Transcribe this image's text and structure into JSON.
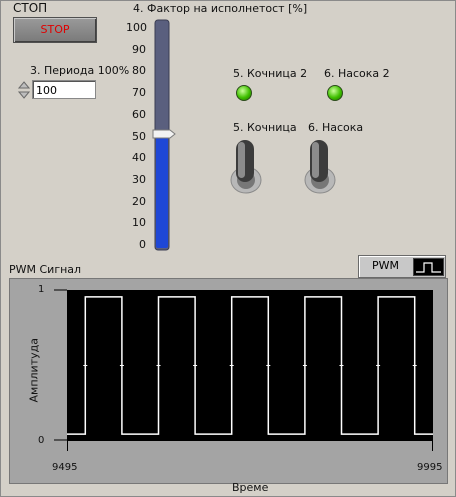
{
  "stop_control": {
    "label": "СТОП",
    "button_text": "STOP"
  },
  "period_control": {
    "label": "3. Периода 100%",
    "value": "100"
  },
  "duty_slider": {
    "label": "4. Фактор на исполнетост [%]",
    "ticks": [
      "100",
      "90",
      "80",
      "70",
      "60",
      "50",
      "40",
      "30",
      "20",
      "10",
      "0"
    ],
    "value": 50,
    "fill_color": "#1e47d6",
    "track_color": "#6b7090"
  },
  "indicators": [
    {
      "label": "5. Кочница 2",
      "state": "on",
      "color": "#3fbf00"
    },
    {
      "label": "6. Насока  2",
      "state": "on",
      "color": "#3fbf00"
    }
  ],
  "switches": [
    {
      "label": "5. Кочница"
    },
    {
      "label": "6. Насока"
    }
  ],
  "graph": {
    "title": "PWM Сигнал",
    "legend_label": "PWM",
    "xlabel": "Време",
    "ylabel": "Амплитуда",
    "x_tick_labels": [
      "9495",
      "9995"
    ],
    "y_tick_labels": [
      "1",
      "0"
    ]
  },
  "chart_data": {
    "type": "line",
    "xlabel": "Време",
    "ylabel": "Амплитуда",
    "xlim": [
      9495,
      9995
    ],
    "ylim": [
      -0.05,
      1.05
    ],
    "series": [
      {
        "name": "PWM",
        "color": "#ffffff",
        "x": [
          9495,
          9520,
          9520,
          9570,
          9570,
          9620,
          9620,
          9670,
          9670,
          9720,
          9720,
          9770,
          9770,
          9820,
          9820,
          9870,
          9870,
          9920,
          9920,
          9970,
          9970,
          9995
        ],
        "y": [
          0,
          0,
          1,
          1,
          0,
          0,
          1,
          1,
          0,
          0,
          1,
          1,
          0,
          0,
          1,
          1,
          0,
          0,
          1,
          1,
          0,
          0
        ]
      }
    ]
  }
}
